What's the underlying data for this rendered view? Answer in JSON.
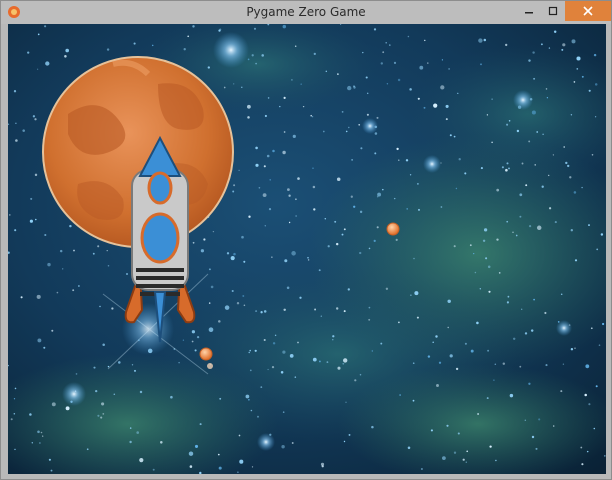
{
  "window": {
    "title": "Pygame Zero Game",
    "controls": {
      "minimize_icon": "minimize-icon",
      "maximize_icon": "maximize-icon",
      "close_icon": "close-icon"
    }
  },
  "scene": {
    "background": "starfield-nebula",
    "sprites": [
      "planet",
      "rocket",
      "projectile",
      "projectile"
    ]
  },
  "colors": {
    "space_dark": "#0b2236",
    "space_mid": "#16486b",
    "nebula_green": "#2e6f5f",
    "planet_orange": "#d7773a",
    "rocket_body": "#c9c9c9",
    "rocket_blue": "#3b8fd6",
    "close_button": "#e0823b"
  }
}
